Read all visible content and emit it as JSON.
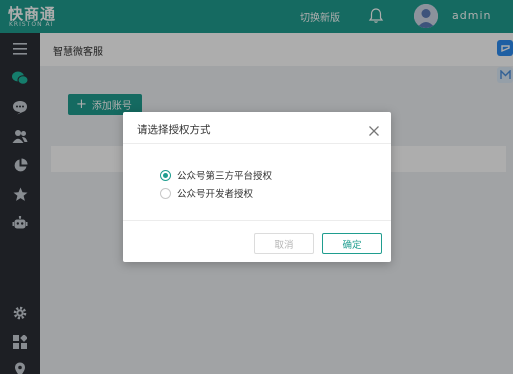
{
  "header": {
    "logo_main": "快商通",
    "logo_sub": "KRISTON AI",
    "switch_label": "切换新版",
    "username": "admin"
  },
  "sidebar": {
    "icons": [
      "menu-toggle-icon",
      "wechat-icon",
      "chat-bubble-icon",
      "users-icon",
      "pie-chart-icon",
      "star-icon",
      "robot-icon",
      "settings-icon",
      "apps-grid-icon",
      "location-pin-icon"
    ]
  },
  "main": {
    "page_title": "智慧微客服",
    "add_account_label": "添加账号"
  },
  "dialog": {
    "title": "请选择授权方式",
    "options": [
      {
        "label": "公众号第三方平台授权",
        "checked": true
      },
      {
        "label": "公众号开发者授权",
        "checked": false
      }
    ],
    "cancel_label": "取消",
    "confirm_label": "确定"
  },
  "colors": {
    "brand": "#1f9d8f",
    "sidebar": "#2b2f36"
  }
}
